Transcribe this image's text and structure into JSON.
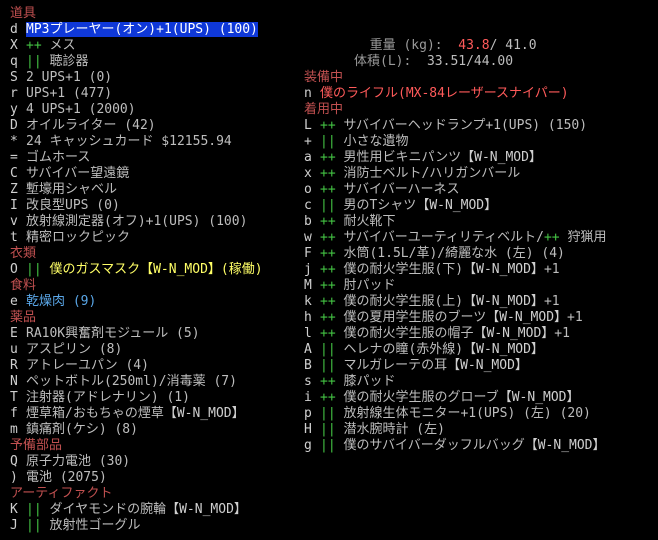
{
  "header": {
    "weight_label": "重量 (kg):",
    "weight_current": "43.8",
    "weight_max": "/ 41.0",
    "volume_label": "体積(L):",
    "volume_value": "33.51/44.00"
  },
  "left": [
    {
      "type": "cat",
      "label": "道具"
    },
    {
      "type": "item",
      "key": "d",
      "text": "MP3プレーヤー(オン)+1(UPS) (100)",
      "selected": true
    },
    {
      "type": "item",
      "key": "X",
      "mark": "++",
      "text": "メス"
    },
    {
      "type": "item",
      "key": "q",
      "mark": "||",
      "text": "聴診器"
    },
    {
      "type": "item",
      "key": "S",
      "text": "2 UPS+1 (0)"
    },
    {
      "type": "item",
      "key": "r",
      "text": "UPS+1 (477)"
    },
    {
      "type": "item",
      "key": "y",
      "text": "4 UPS+1 (2000)"
    },
    {
      "type": "item",
      "key": "D",
      "text": "オイルライター (42)"
    },
    {
      "type": "item",
      "key": "*",
      "text": "24 キャッシュカード $12155.94"
    },
    {
      "type": "item",
      "key": "=",
      "text": "ゴムホース"
    },
    {
      "type": "item",
      "key": "C",
      "text": "サバイバー望遠鏡"
    },
    {
      "type": "item",
      "key": "Z",
      "text": "塹壕用シャベル"
    },
    {
      "type": "item",
      "key": "I",
      "text": "改良型UPS (0)"
    },
    {
      "type": "item",
      "key": "v",
      "text": "放射線測定器(オフ)+1(UPS) (100)"
    },
    {
      "type": "item",
      "key": "t",
      "text": "精密ロックピック"
    },
    {
      "type": "cat",
      "label": "衣類"
    },
    {
      "type": "item",
      "key": "O",
      "mark": "||",
      "text": "僕のガスマスク",
      "mod": "【W-N_MOD】",
      "suffix": "(稼働)",
      "color": "yellow"
    },
    {
      "type": "cat",
      "label": "食料"
    },
    {
      "type": "item",
      "key": "e",
      "text": "乾燥肉",
      "suffix": " (9)",
      "color": "cyan"
    },
    {
      "type": "cat",
      "label": "薬品"
    },
    {
      "type": "item",
      "key": "E",
      "text": "RA10K興奮剤モジュール (5)"
    },
    {
      "type": "item",
      "key": "u",
      "text": "アスピリン (8)"
    },
    {
      "type": "item",
      "key": "R",
      "text": "アトレーユパン (4)"
    },
    {
      "type": "item",
      "key": "N",
      "text": "ペットボトル(250ml)/消毒薬 (7)"
    },
    {
      "type": "item",
      "key": "T",
      "text": "注射器(アドレナリン) (1)"
    },
    {
      "type": "item",
      "key": "f",
      "text": "煙草箱/おもちゃの煙草",
      "mod": "【W-N_MOD】"
    },
    {
      "type": "item",
      "key": "m",
      "text": "鎮痛剤(ケシ) (8)"
    },
    {
      "type": "cat",
      "label": "予備部品"
    },
    {
      "type": "item",
      "key": "Q",
      "text": "原子力電池 (30)"
    },
    {
      "type": "item",
      "key": ")",
      "text": "電池 (2075)"
    },
    {
      "type": "cat",
      "label": "アーティファクト"
    },
    {
      "type": "item",
      "key": "K",
      "mark": "||",
      "text": "ダイヤモンドの腕輪",
      "mod": "【W-N_MOD】"
    },
    {
      "type": "item",
      "key": "J",
      "mark": "||",
      "text": "放射性ゴーグル"
    }
  ],
  "right": [
    {
      "type": "cat",
      "label": "装備中"
    },
    {
      "type": "item",
      "key": "n",
      "text": "僕のライフル(MX-84レーザースナイパー)",
      "color": "red"
    },
    {
      "type": "cat",
      "label": "着用中"
    },
    {
      "type": "item",
      "key": "L",
      "mark": "++",
      "text": "サバイバーヘッドランプ+1(UPS) (150)"
    },
    {
      "type": "item",
      "key": "+",
      "mark": "||",
      "text": "小さな遺物"
    },
    {
      "type": "item",
      "key": "a",
      "mark": "++",
      "text": "男性用ビキニパンツ",
      "mod": "【W-N_MOD】"
    },
    {
      "type": "item",
      "key": "x",
      "mark": "++",
      "text": "消防士ベルト/ハリガンバール"
    },
    {
      "type": "item",
      "key": "o",
      "mark": "++",
      "text": "サバイバーハーネス"
    },
    {
      "type": "item",
      "key": "c",
      "mark": "||",
      "text": "男のTシャツ",
      "mod": "【W-N_MOD】"
    },
    {
      "type": "item",
      "key": "b",
      "mark": "++",
      "text": "耐火靴下"
    },
    {
      "type": "item",
      "key": "w",
      "mark": "++",
      "text": "サバイバーユーティリティベルト/",
      "mark2": "++",
      "text2": " 狩猟用"
    },
    {
      "type": "item",
      "key": "F",
      "mark": "++",
      "text": "水筒(1.5L/革)/綺麗な水 (左) (4)"
    },
    {
      "type": "item",
      "key": "j",
      "mark": "++",
      "text": "僕の耐火学生服(下)",
      "mod": "【W-N_MOD】",
      "suffix": "+1"
    },
    {
      "type": "item",
      "key": "M",
      "mark": "++",
      "text": "肘パッド"
    },
    {
      "type": "item",
      "key": "k",
      "mark": "++",
      "text": "僕の耐火学生服(上)",
      "mod": "【W-N_MOD】",
      "suffix": "+1"
    },
    {
      "type": "item",
      "key": "h",
      "mark": "++",
      "text": "僕の夏用学生服のブーツ",
      "mod": "【W-N_MOD】",
      "suffix": "+1"
    },
    {
      "type": "item",
      "key": "l",
      "mark": "++",
      "text": "僕の耐火学生服の帽子",
      "mod": "【W-N_MOD】",
      "suffix": "+1"
    },
    {
      "type": "item",
      "key": "A",
      "mark": "||",
      "text": "ヘレナの瞳(赤外線)",
      "mod": "【W-N_MOD】"
    },
    {
      "type": "item",
      "key": "B",
      "mark": "||",
      "text": "マルガレーテの耳",
      "mod": "【W-N_MOD】"
    },
    {
      "type": "item",
      "key": "s",
      "mark": "++",
      "text": "膝パッド"
    },
    {
      "type": "item",
      "key": "i",
      "mark": "++",
      "text": "僕の耐火学生服のグローブ",
      "mod": "【W-N_MOD】"
    },
    {
      "type": "item",
      "key": "p",
      "mark": "||",
      "text": "放射線生体モニター+1(UPS) (左) (20)"
    },
    {
      "type": "item",
      "key": "H",
      "mark": "||",
      "text": "潜水腕時計 (左)"
    },
    {
      "type": "item",
      "key": "g",
      "mark": "||",
      "text": "僕のサバイバーダッフルバッグ",
      "mod": "【W-N_MOD】"
    }
  ]
}
